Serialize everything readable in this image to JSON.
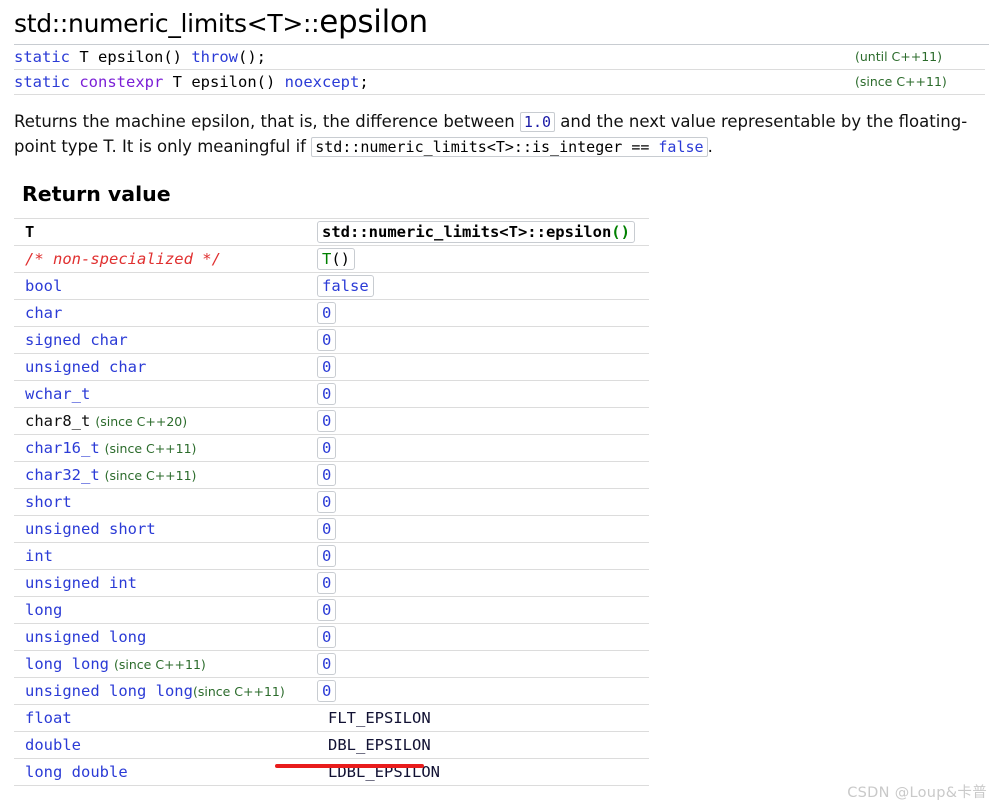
{
  "page": {
    "title_prefix": "std::numeric_limits<T>::",
    "title_name": "epsilon",
    "watermark": "CSDN @Loup&卡普"
  },
  "declarations": [
    {
      "tokens": [
        {
          "t": "static",
          "c": "kw"
        },
        {
          "t": " T epsilon",
          "c": "ident"
        },
        {
          "t": "() ",
          "c": "punc"
        },
        {
          "t": "throw",
          "c": "kw"
        },
        {
          "t": "();",
          "c": "punc"
        }
      ],
      "text": "static T epsilon() throw();",
      "version": "(until C++11)"
    },
    {
      "tokens": [
        {
          "t": "static",
          "c": "kw"
        },
        {
          "t": " ",
          "c": "punc"
        },
        {
          "t": "constexpr",
          "c": "kw2"
        },
        {
          "t": " T epsilon",
          "c": "ident"
        },
        {
          "t": "() ",
          "c": "punc"
        },
        {
          "t": "noexcept",
          "c": "kw"
        },
        {
          "t": ";",
          "c": "punc"
        }
      ],
      "text": "static constexpr T epsilon() noexcept;",
      "version": "(since C++11)"
    }
  ],
  "description": {
    "part1": "Returns the machine epsilon, that is, the difference between ",
    "code1": "1.0",
    "part2": " and the next value representable by the floating-point type T. It is only meaningful if ",
    "code2_a": "std::numeric_limits<T>::is_integer ",
    "code2_b": "== ",
    "code2_c": "false",
    "part3": "."
  },
  "return_value": {
    "heading": "Return value",
    "columns": {
      "type": "T",
      "value": "std::numeric_limits<T>::epsilon()",
      "value_name": "std::numeric_limits<T>::epsilon",
      "value_parens": "()"
    },
    "rows": [
      {
        "type": "/* non-specialized */",
        "style": "comment",
        "since": "",
        "value": "T()",
        "value_style": "box-green-t"
      },
      {
        "type": "bool",
        "style": "keyword",
        "since": "",
        "value": "false",
        "value_style": "box-blue"
      },
      {
        "type": "char",
        "style": "keyword",
        "since": "",
        "value": "0",
        "value_style": "box-blue"
      },
      {
        "type": "signed char",
        "style": "keyword",
        "since": "",
        "value": "0",
        "value_style": "box-blue"
      },
      {
        "type": "unsigned char",
        "style": "keyword",
        "since": "",
        "value": "0",
        "value_style": "box-blue"
      },
      {
        "type": "wchar_t",
        "style": "keyword",
        "since": "",
        "value": "0",
        "value_style": "box-blue"
      },
      {
        "type": "char8_t",
        "style": "dark",
        "since": "(since C++20)",
        "since_gap": "spaced",
        "value": "0",
        "value_style": "box-blue"
      },
      {
        "type": "char16_t",
        "style": "keyword",
        "since": "(since C++11)",
        "since_gap": "spaced",
        "value": "0",
        "value_style": "box-blue"
      },
      {
        "type": "char32_t",
        "style": "keyword",
        "since": "(since C++11)",
        "since_gap": "spaced",
        "value": "0",
        "value_style": "box-blue"
      },
      {
        "type": "short",
        "style": "keyword",
        "since": "",
        "value": "0",
        "value_style": "box-blue"
      },
      {
        "type": "unsigned short",
        "style": "keyword",
        "since": "",
        "value": "0",
        "value_style": "box-blue"
      },
      {
        "type": "int",
        "style": "keyword",
        "since": "",
        "value": "0",
        "value_style": "box-blue"
      },
      {
        "type": "unsigned int",
        "style": "keyword",
        "since": "",
        "value": "0",
        "value_style": "box-blue"
      },
      {
        "type": "long",
        "style": "keyword",
        "since": "",
        "value": "0",
        "value_style": "box-blue"
      },
      {
        "type": "unsigned long",
        "style": "keyword",
        "since": "",
        "value": "0",
        "value_style": "box-blue"
      },
      {
        "type": "long long",
        "style": "keyword",
        "since": "(since C++11)",
        "since_gap": "spaced",
        "value": "0",
        "value_style": "box-blue"
      },
      {
        "type": "unsigned long long",
        "style": "keyword",
        "since": "(since C++11)",
        "since_gap": "tight",
        "value": "0",
        "value_style": "box-blue"
      },
      {
        "type": "float",
        "style": "keyword",
        "since": "",
        "value": "FLT_EPSILON",
        "value_style": "plain"
      },
      {
        "type": "double",
        "style": "keyword",
        "since": "",
        "value": "DBL_EPSILON",
        "value_style": "plain"
      },
      {
        "type": "long double",
        "style": "keyword",
        "since": "",
        "value": "LDBL_EPSILON",
        "value_style": "plain"
      }
    ]
  },
  "annotation": {
    "underline_color": "#e81c1c",
    "underlines_row": "double"
  }
}
